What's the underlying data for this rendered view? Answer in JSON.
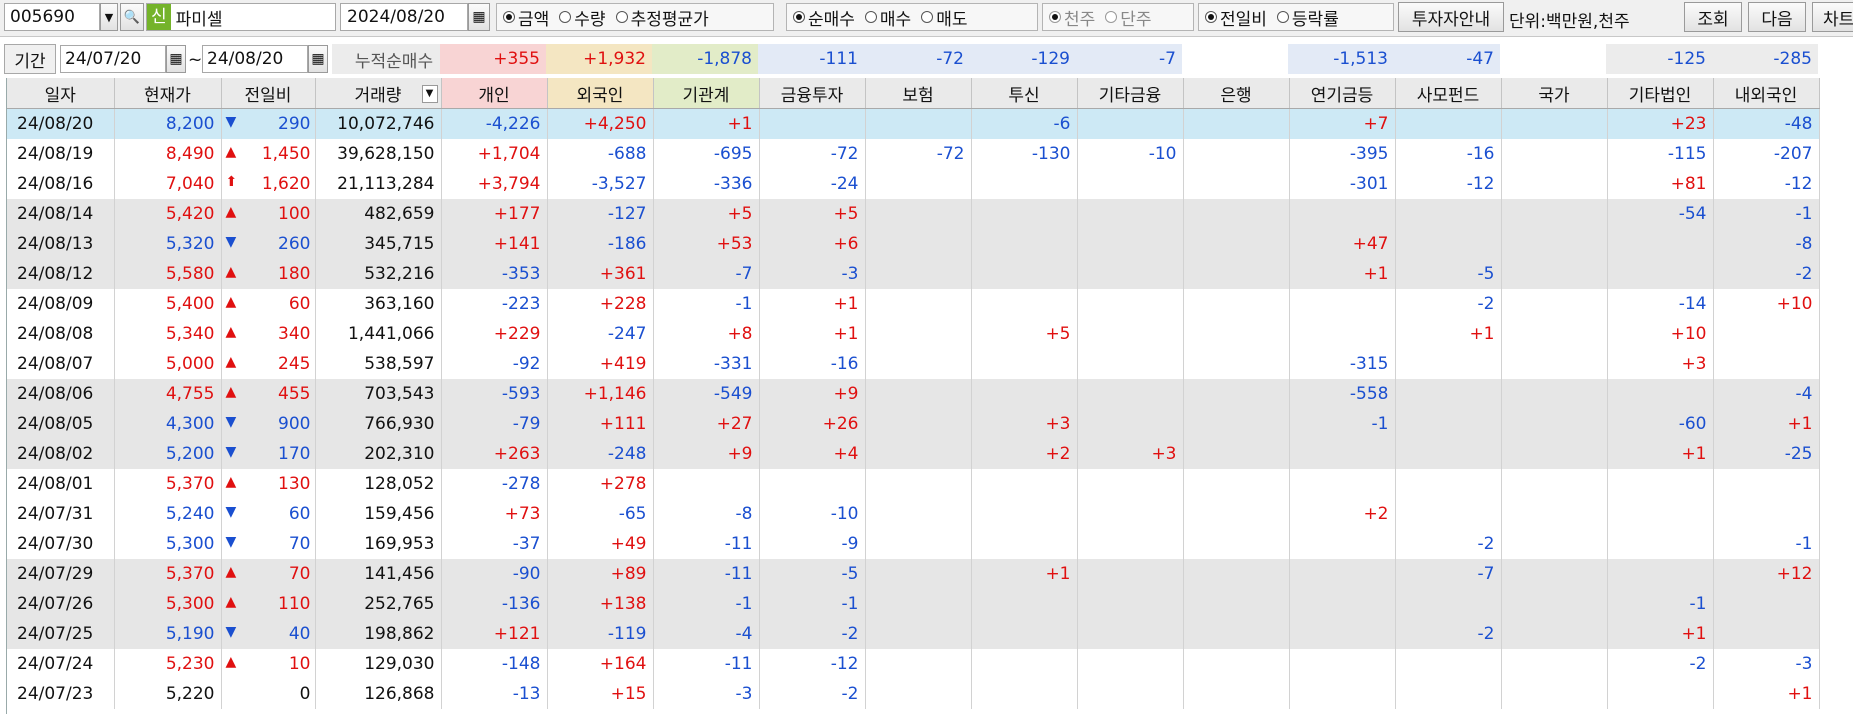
{
  "toolbar": {
    "code": "005690",
    "dropdown_glyph": "▼",
    "search_glyph": "🔍",
    "badge": "신",
    "stock_name": "파미셀",
    "date": "2024/08/20",
    "calendar_glyph": "▦",
    "group1": [
      {
        "label": "금액",
        "on": true
      },
      {
        "label": "수량",
        "on": false
      },
      {
        "label": "추정평균가",
        "on": false
      }
    ],
    "group2": [
      {
        "label": "순매수",
        "on": true
      },
      {
        "label": "매수",
        "on": false
      },
      {
        "label": "매도",
        "on": false
      }
    ],
    "group3": [
      {
        "label": "천주",
        "on": true
      },
      {
        "label": "단주",
        "on": false
      }
    ],
    "group4": [
      {
        "label": "전일비",
        "on": true
      },
      {
        "label": "등락률",
        "on": false
      }
    ],
    "guide_button": "투자자안내",
    "unit_label": "단위:백만원,천주",
    "query_button": "조회",
    "next_button": "다음",
    "chart_button": "차트"
  },
  "period": {
    "label": "기간",
    "start": "24/07/20",
    "sep": "~",
    "end": "24/08/20",
    "cumulative_label": "누적순매수",
    "cumulative": [
      "+355",
      "+1,932",
      "-1,878",
      "-111",
      "-72",
      "-129",
      "-7",
      "",
      "-1,513",
      "-47",
      "",
      "-125",
      "-285"
    ]
  },
  "columns": [
    "일자",
    "현재가",
    "전일비",
    "거래량",
    "개인",
    "외국인",
    "기관계",
    "금융투자",
    "보험",
    "투신",
    "기타금융",
    "은행",
    "연기금등",
    "사모펀드",
    "국가",
    "기타법인",
    "내외국인"
  ],
  "sort_glyph": "▼",
  "colors": {
    "up": "#e01010",
    "down": "#1a4fd0",
    "selected_row": "#cde9f5",
    "gray_row": "#e6e6e6",
    "individual_header": "#f8d4d4",
    "foreign_header": "#f4e6c2",
    "inst_header": "#e2ecc8",
    "inst_cum_bg": "#e8f0dc",
    "blue_cum_bg": "#e3eaf6"
  },
  "rows": [
    {
      "date": "24/08/20",
      "price": "8,200",
      "arrow": "▼",
      "change": "290",
      "volume": "10,072,746",
      "vals": [
        "-4,226",
        "+4,250",
        "+1",
        "",
        "",
        "-6",
        "",
        "",
        "+7",
        "",
        "",
        "+23",
        "-48"
      ]
    },
    {
      "date": "24/08/19",
      "price": "8,490",
      "arrow": "▲",
      "change": "1,450",
      "volume": "39,628,150",
      "vals": [
        "+1,704",
        "-688",
        "-695",
        "-72",
        "-72",
        "-130",
        "-10",
        "",
        "-395",
        "-16",
        "",
        "-115",
        "-207"
      ]
    },
    {
      "date": "24/08/16",
      "price": "7,040",
      "arrow": "⬆",
      "change": "1,620",
      "volume": "21,113,284",
      "vals": [
        "+3,794",
        "-3,527",
        "-336",
        "-24",
        "",
        "",
        "",
        "",
        "-301",
        "-12",
        "",
        "+81",
        "-12"
      ]
    },
    {
      "date": "24/08/14",
      "price": "5,420",
      "arrow": "▲",
      "change": "100",
      "volume": "482,659",
      "vals": [
        "+177",
        "-127",
        "+5",
        "+5",
        "",
        "",
        "",
        "",
        "",
        "",
        "",
        "-54",
        "-1"
      ]
    },
    {
      "date": "24/08/13",
      "price": "5,320",
      "arrow": "▼",
      "change": "260",
      "volume": "345,715",
      "vals": [
        "+141",
        "-186",
        "+53",
        "+6",
        "",
        "",
        "",
        "",
        "+47",
        "",
        "",
        "",
        "-8"
      ]
    },
    {
      "date": "24/08/12",
      "price": "5,580",
      "arrow": "▲",
      "change": "180",
      "volume": "532,216",
      "vals": [
        "-353",
        "+361",
        "-7",
        "-3",
        "",
        "",
        "",
        "",
        "+1",
        "-5",
        "",
        "",
        "-2"
      ]
    },
    {
      "date": "24/08/09",
      "price": "5,400",
      "arrow": "▲",
      "change": "60",
      "volume": "363,160",
      "vals": [
        "-223",
        "+228",
        "-1",
        "+1",
        "",
        "",
        "",
        "",
        "",
        "-2",
        "",
        "-14",
        "+10"
      ]
    },
    {
      "date": "24/08/08",
      "price": "5,340",
      "arrow": "▲",
      "change": "340",
      "volume": "1,441,066",
      "vals": [
        "+229",
        "-247",
        "+8",
        "+1",
        "",
        "+5",
        "",
        "",
        "",
        "+1",
        "",
        "+10",
        ""
      ]
    },
    {
      "date": "24/08/07",
      "price": "5,000",
      "arrow": "▲",
      "change": "245",
      "volume": "538,597",
      "vals": [
        "-92",
        "+419",
        "-331",
        "-16",
        "",
        "",
        "",
        "",
        "-315",
        "",
        "",
        "+3",
        ""
      ]
    },
    {
      "date": "24/08/06",
      "price": "4,755",
      "arrow": "▲",
      "change": "455",
      "volume": "703,543",
      "vals": [
        "-593",
        "+1,146",
        "-549",
        "+9",
        "",
        "",
        "",
        "",
        "-558",
        "",
        "",
        "",
        "-4"
      ]
    },
    {
      "date": "24/08/05",
      "price": "4,300",
      "arrow": "▼",
      "change": "900",
      "volume": "766,930",
      "vals": [
        "-79",
        "+111",
        "+27",
        "+26",
        "",
        "+3",
        "",
        "",
        "-1",
        "",
        "",
        "-60",
        "+1"
      ]
    },
    {
      "date": "24/08/02",
      "price": "5,200",
      "arrow": "▼",
      "change": "170",
      "volume": "202,310",
      "vals": [
        "+263",
        "-248",
        "+9",
        "+4",
        "",
        "+2",
        "+3",
        "",
        "",
        "",
        "",
        "+1",
        "-25"
      ]
    },
    {
      "date": "24/08/01",
      "price": "5,370",
      "arrow": "▲",
      "change": "130",
      "volume": "128,052",
      "vals": [
        "-278",
        "+278",
        "",
        "",
        "",
        "",
        "",
        "",
        "",
        "",
        "",
        "",
        ""
      ]
    },
    {
      "date": "24/07/31",
      "price": "5,240",
      "arrow": "▼",
      "change": "60",
      "volume": "159,456",
      "vals": [
        "+73",
        "-65",
        "-8",
        "-10",
        "",
        "",
        "",
        "",
        "+2",
        "",
        "",
        "",
        ""
      ]
    },
    {
      "date": "24/07/30",
      "price": "5,300",
      "arrow": "▼",
      "change": "70",
      "volume": "169,953",
      "vals": [
        "-37",
        "+49",
        "-11",
        "-9",
        "",
        "",
        "",
        "",
        "",
        "-2",
        "",
        "",
        "-1"
      ]
    },
    {
      "date": "24/07/29",
      "price": "5,370",
      "arrow": "▲",
      "change": "70",
      "volume": "141,456",
      "vals": [
        "-90",
        "+89",
        "-11",
        "-5",
        "",
        "+1",
        "",
        "",
        "",
        "-7",
        "",
        "",
        "+12"
      ]
    },
    {
      "date": "24/07/26",
      "price": "5,300",
      "arrow": "▲",
      "change": "110",
      "volume": "252,765",
      "vals": [
        "-136",
        "+138",
        "-1",
        "-1",
        "",
        "",
        "",
        "",
        "",
        "",
        "",
        "-1",
        ""
      ]
    },
    {
      "date": "24/07/25",
      "price": "5,190",
      "arrow": "▼",
      "change": "40",
      "volume": "198,862",
      "vals": [
        "+121",
        "-119",
        "-4",
        "-2",
        "",
        "",
        "",
        "",
        "",
        "-2",
        "",
        "+1",
        ""
      ]
    },
    {
      "date": "24/07/24",
      "price": "5,230",
      "arrow": "▲",
      "change": "10",
      "volume": "129,030",
      "vals": [
        "-148",
        "+164",
        "-11",
        "-12",
        "",
        "",
        "",
        "",
        "",
        "",
        "",
        "-2",
        "-3"
      ]
    },
    {
      "date": "24/07/23",
      "price": "5,220",
      "arrow": "",
      "change": "0",
      "volume": "126,868",
      "vals": [
        "-13",
        "+15",
        "-3",
        "-2",
        "",
        "",
        "",
        "",
        "",
        "",
        "",
        "",
        "+1"
      ]
    }
  ]
}
